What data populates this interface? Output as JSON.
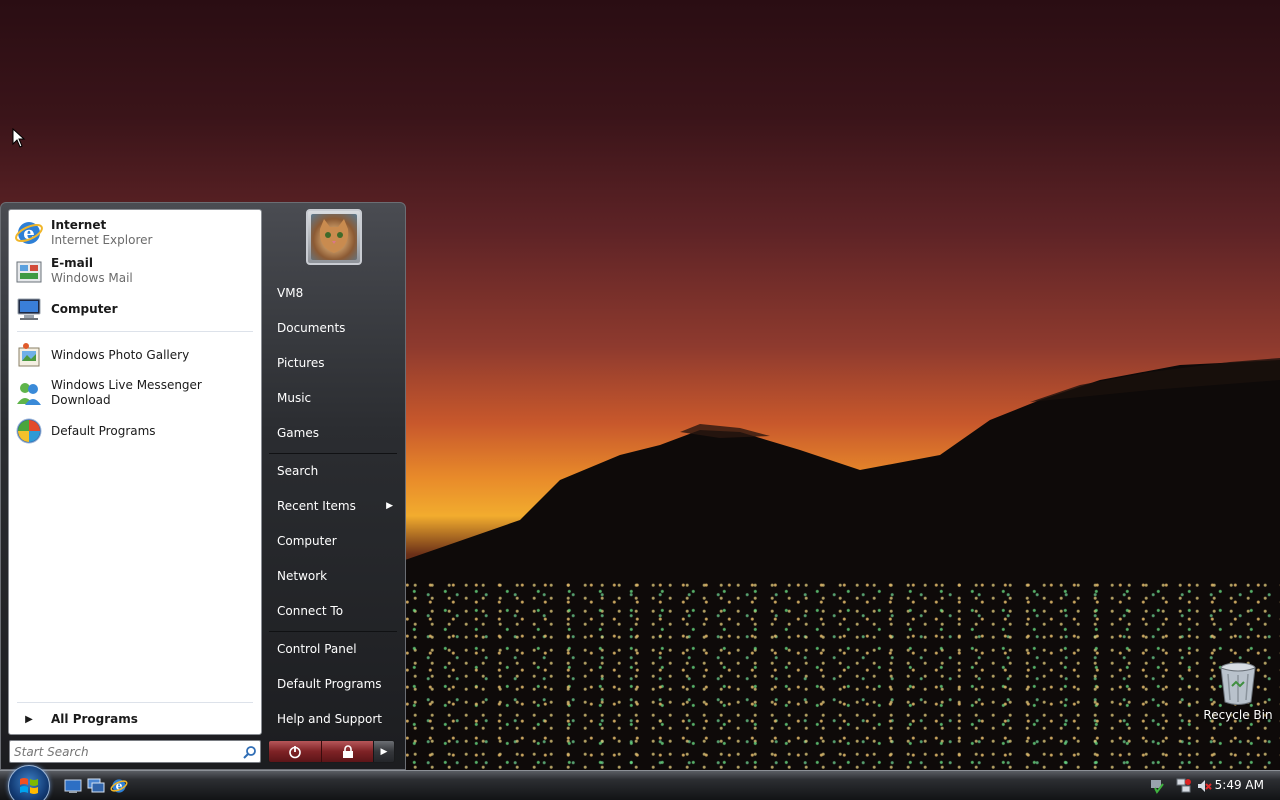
{
  "desktop": {
    "recycle_bin_label": "Recycle Bin",
    "icons": [
      "recycle-bin-icon",
      "mouse-cursor-icon"
    ]
  },
  "start_menu": {
    "pinned": [
      {
        "title": "Internet",
        "subtitle": "Internet Explorer",
        "icon": "internet-explorer-icon"
      },
      {
        "title": "E-mail",
        "subtitle": "Windows Mail",
        "icon": "windows-mail-icon"
      },
      {
        "title": "Computer",
        "subtitle": "",
        "icon": "computer-icon"
      }
    ],
    "recent": [
      {
        "title": "Windows Photo Gallery",
        "icon": "photo-gallery-icon"
      },
      {
        "title": "Windows Live Messenger Download",
        "icon": "messenger-icon"
      },
      {
        "title": "Default Programs",
        "icon": "default-programs-icon"
      }
    ],
    "all_programs_label": "All Programs",
    "search_placeholder": "Start Search",
    "right_pane": {
      "user_name": "VM8",
      "items": [
        "Documents",
        "Pictures",
        "Music",
        "Games",
        "Search",
        "Recent Items",
        "Computer",
        "Network",
        "Connect To",
        "Control Panel",
        "Default Programs",
        "Help and Support"
      ]
    },
    "power_buttons": [
      "power-icon",
      "lock-icon",
      "arrow-right-icon"
    ]
  },
  "taskbar": {
    "quick_launch": [
      "show-desktop-icon",
      "switch-windows-icon",
      "internet-explorer-icon"
    ],
    "tray": [
      "safely-remove-hardware-icon",
      "network-icon",
      "volume-muted-icon"
    ],
    "clock": "5:49 AM"
  },
  "colors": {
    "start_menu_dark": "#2b2d31",
    "power_red": "#7e2225",
    "taskbar": "#2c2e32"
  }
}
